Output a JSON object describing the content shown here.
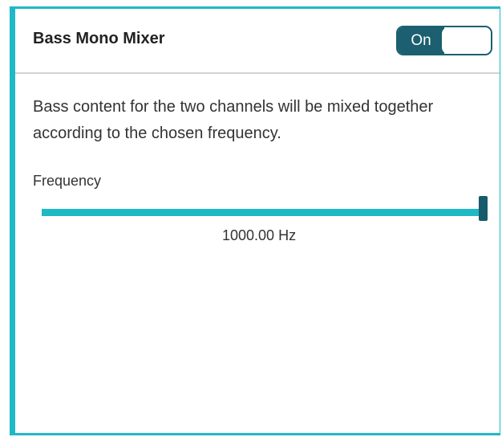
{
  "mixer": {
    "title": "Bass Mono Mixer",
    "toggle_label": "On",
    "toggle_state": "on",
    "description": "Bass content for the two channels will be mixed together according to the chosen frequency.",
    "frequency": {
      "label": "Frequency",
      "value_text": "1000.00 Hz",
      "value": 1000.0,
      "unit": "Hz",
      "level_fraction": 1.0
    }
  },
  "colors": {
    "accent": "#1fb9c6",
    "toggle": "#1b5f70",
    "handle": "#165b6b"
  }
}
